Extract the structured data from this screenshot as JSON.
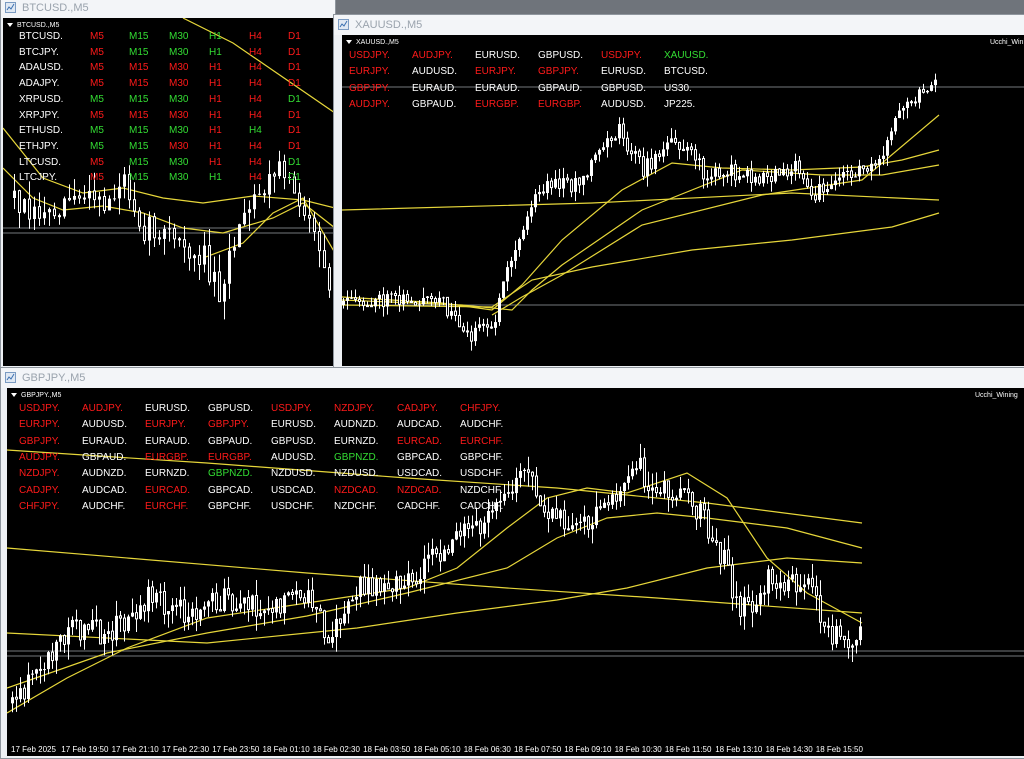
{
  "colors": {
    "red": "#ff1a1a",
    "green": "#33dd33",
    "white": "#ffffff",
    "ma": "#e6d63a",
    "bg": "#000000"
  },
  "windows": {
    "btc": {
      "title": "BTCUSD.,M5",
      "label": "BTCUSD.,M5",
      "rows": [
        {
          "sym": "BTCUSD.",
          "tf": [
            "M5",
            "M15",
            "M30",
            "H1",
            "H4",
            "D1"
          ],
          "c": [
            "r",
            "g",
            "g",
            "g",
            "r",
            "r"
          ]
        },
        {
          "sym": "BTCJPY.",
          "tf": [
            "M5",
            "M15",
            "M30",
            "H1",
            "H4",
            "D1"
          ],
          "c": [
            "r",
            "g",
            "g",
            "g",
            "r",
            "r"
          ]
        },
        {
          "sym": "ADAUSD.",
          "tf": [
            "M5",
            "M15",
            "M30",
            "H1",
            "H4",
            "D1"
          ],
          "c": [
            "r",
            "r",
            "r",
            "r",
            "r",
            "r"
          ]
        },
        {
          "sym": "ADAJPY.",
          "tf": [
            "M5",
            "M15",
            "M30",
            "H1",
            "H4",
            "D1"
          ],
          "c": [
            "r",
            "r",
            "r",
            "r",
            "r",
            "r"
          ]
        },
        {
          "sym": "XRPUSD.",
          "tf": [
            "M5",
            "M15",
            "M30",
            "H1",
            "H4",
            "D1"
          ],
          "c": [
            "g",
            "g",
            "g",
            "r",
            "r",
            "g"
          ]
        },
        {
          "sym": "XRPJPY.",
          "tf": [
            "M5",
            "M15",
            "M30",
            "H1",
            "H4",
            "D1"
          ],
          "c": [
            "r",
            "r",
            "r",
            "r",
            "r",
            "r"
          ]
        },
        {
          "sym": "ETHUSD.",
          "tf": [
            "M5",
            "M15",
            "M30",
            "H1",
            "H4",
            "D1"
          ],
          "c": [
            "g",
            "g",
            "g",
            "r",
            "g",
            "r"
          ]
        },
        {
          "sym": "ETHJPY.",
          "tf": [
            "M5",
            "M15",
            "M30",
            "H1",
            "H4",
            "D1"
          ],
          "c": [
            "g",
            "g",
            "r",
            "r",
            "r",
            "r"
          ]
        },
        {
          "sym": "LTCUSD.",
          "tf": [
            "M5",
            "M15",
            "M30",
            "H1",
            "H4",
            "D1"
          ],
          "c": [
            "r",
            "g",
            "g",
            "r",
            "r",
            "g"
          ]
        },
        {
          "sym": "LTCJPY.",
          "tf": [
            "M5",
            "M15",
            "M30",
            "H1",
            "H4",
            "D1"
          ],
          "c": [
            "r",
            "g",
            "g",
            "g",
            "r",
            "g"
          ]
        }
      ]
    },
    "xau": {
      "title": "XAUUSD.,M5",
      "label": "XAUUSD.,M5",
      "ea": "Ucchi_Wini",
      "grid": [
        [
          [
            "USDJPY.",
            "r"
          ],
          [
            "AUDJPY.",
            "r"
          ],
          [
            "EURUSD.",
            "w"
          ],
          [
            "GBPUSD.",
            "w"
          ],
          [
            "USDJPY.",
            "r"
          ],
          [
            "XAUUSD.",
            "g"
          ]
        ],
        [
          [
            "EURJPY.",
            "r"
          ],
          [
            "AUDUSD.",
            "w"
          ],
          [
            "EURJPY.",
            "r"
          ],
          [
            "GBPJPY.",
            "r"
          ],
          [
            "EURUSD.",
            "w"
          ],
          [
            "BTCUSD.",
            "w"
          ]
        ],
        [
          [
            "GBPJPY.",
            "r"
          ],
          [
            "EURAUD.",
            "w"
          ],
          [
            "EURAUD.",
            "w"
          ],
          [
            "GBPAUD.",
            "w"
          ],
          [
            "GBPUSD.",
            "w"
          ],
          [
            "US30.",
            "w"
          ]
        ],
        [
          [
            "AUDJPY.",
            "r"
          ],
          [
            "GBPAUD.",
            "w"
          ],
          [
            "EURGBP.",
            "r"
          ],
          [
            "EURGBP.",
            "r"
          ],
          [
            "AUDUSD.",
            "w"
          ],
          [
            "JP225.",
            "w"
          ]
        ]
      ]
    },
    "gbp": {
      "title": "GBPJPY.,M5",
      "label": "GBPJPY.,M5",
      "ea": "Ucchi_Wining",
      "grid": [
        [
          [
            "USDJPY.",
            "r"
          ],
          [
            "AUDJPY.",
            "r"
          ],
          [
            "EURUSD.",
            "w"
          ],
          [
            "GBPUSD.",
            "w"
          ],
          [
            "USDJPY.",
            "r"
          ],
          [
            "NZDJPY.",
            "r"
          ],
          [
            "CADJPY.",
            "r"
          ],
          [
            "CHFJPY.",
            "r"
          ]
        ],
        [
          [
            "EURJPY.",
            "r"
          ],
          [
            "AUDUSD.",
            "w"
          ],
          [
            "EURJPY.",
            "r"
          ],
          [
            "GBPJPY.",
            "r"
          ],
          [
            "EURUSD.",
            "w"
          ],
          [
            "AUDNZD.",
            "w"
          ],
          [
            "AUDCAD.",
            "w"
          ],
          [
            "AUDCHF.",
            "w"
          ]
        ],
        [
          [
            "GBPJPY.",
            "r"
          ],
          [
            "EURAUD.",
            "w"
          ],
          [
            "EURAUD.",
            "w"
          ],
          [
            "GBPAUD.",
            "w"
          ],
          [
            "GBPUSD.",
            "w"
          ],
          [
            "EURNZD.",
            "w"
          ],
          [
            "EURCAD.",
            "r"
          ],
          [
            "EURCHF.",
            "r"
          ]
        ],
        [
          [
            "AUDJPY.",
            "r"
          ],
          [
            "GBPAUD.",
            "w"
          ],
          [
            "EURGBP.",
            "r"
          ],
          [
            "EURGBP.",
            "r"
          ],
          [
            "AUDUSD.",
            "w"
          ],
          [
            "GBPNZD.",
            "g"
          ],
          [
            "GBPCAD.",
            "w"
          ],
          [
            "GBPCHF.",
            "w"
          ]
        ],
        [
          [
            "NZDJPY.",
            "r"
          ],
          [
            "AUDNZD.",
            "w"
          ],
          [
            "EURNZD.",
            "w"
          ],
          [
            "GBPNZD.",
            "g"
          ],
          [
            "NZDUSD.",
            "w"
          ],
          [
            "NZDUSD.",
            "w"
          ],
          [
            "USDCAD.",
            "w"
          ],
          [
            "USDCHF.",
            "w"
          ]
        ],
        [
          [
            "CADJPY.",
            "r"
          ],
          [
            "AUDCAD.",
            "w"
          ],
          [
            "EURCAD.",
            "r"
          ],
          [
            "GBPCAD.",
            "w"
          ],
          [
            "USDCAD.",
            "w"
          ],
          [
            "NZDCAD.",
            "r"
          ],
          [
            "NZDCAD.",
            "r"
          ],
          [
            "NZDCHF.",
            "w"
          ]
        ],
        [
          [
            "CHFJPY.",
            "r"
          ],
          [
            "AUDCHF.",
            "w"
          ],
          [
            "EURCHF.",
            "r"
          ],
          [
            "GBPCHF.",
            "w"
          ],
          [
            "USDCHF.",
            "w"
          ],
          [
            "NZDCHF.",
            "w"
          ],
          [
            "CADCHF.",
            "w"
          ],
          [
            "CADCHF.",
            "w"
          ]
        ]
      ],
      "time_axis": [
        "17 Feb 2025",
        "17 Feb 19:50",
        "17 Feb 21:10",
        "17 Feb 22:30",
        "17 Feb 23:50",
        "18 Feb 01:10",
        "18 Feb 02:30",
        "18 Feb 03:50",
        "18 Feb 05:10",
        "18 Feb 06:30",
        "18 Feb 07:50",
        "18 Feb 09:10",
        "18 Feb 10:30",
        "18 Feb 11:50",
        "18 Feb 13:10",
        "18 Feb 14:30",
        "18 Feb 15:50"
      ]
    }
  }
}
